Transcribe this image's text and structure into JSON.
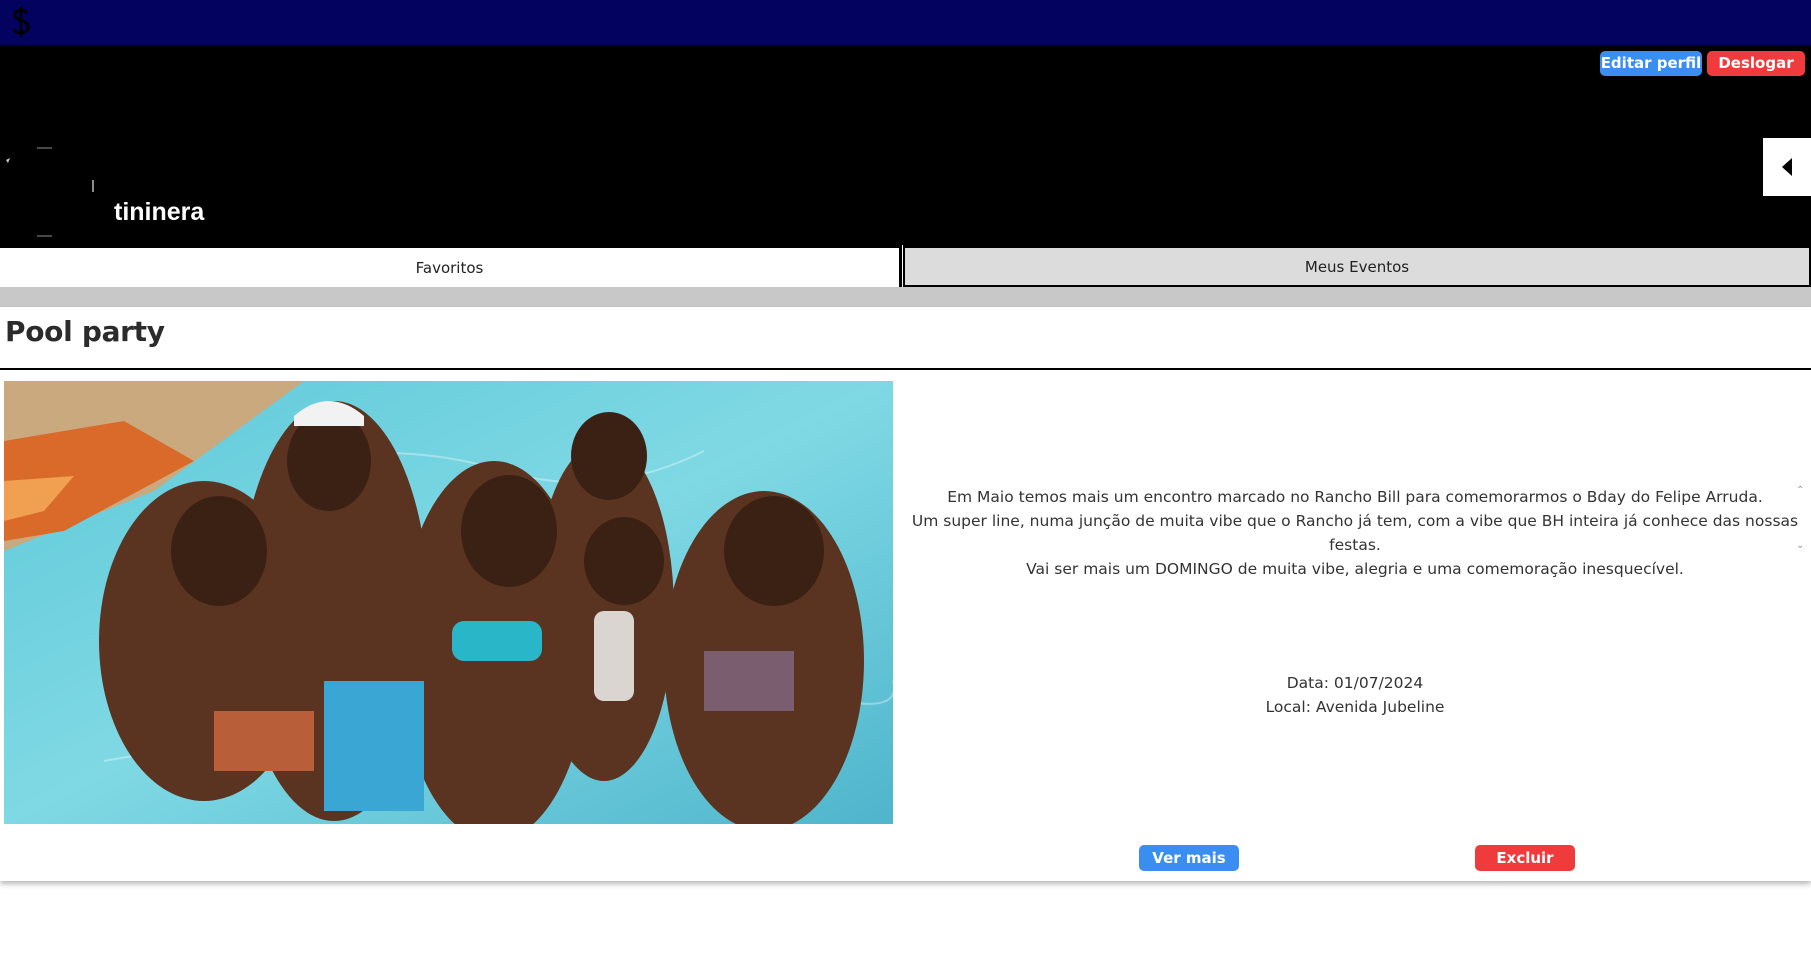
{
  "header": {
    "logo_icon": "dollar-sign-logo-icon",
    "background": "#03035f"
  },
  "profile": {
    "username": "tininera",
    "edit_profile_label": "Editar perfil",
    "logout_label": "Deslogar",
    "avatar_icon": "avatar-icon",
    "toggle_icon": "caret-left-icon"
  },
  "tabs": [
    {
      "label": "Favoritos",
      "active": true
    },
    {
      "label": "Meus Eventos",
      "active": false
    }
  ],
  "event": {
    "title": "Pool party",
    "image_icon": "event-photo",
    "description": [
      "Em Maio temos mais um encontro marcado no Rancho Bill para comemorarmos o Bday do Felipe Arruda.",
      "Um super line, numa junção de muita vibe que o Rancho já tem, com a vibe que BH inteira já conhece das nossas festas.",
      "Vai ser mais um DOMINGO de muita vibe, alegria e uma comemoração inesquecível."
    ],
    "date_text": "Data: 01/07/2024",
    "location_text": "Local: Avenida Jubeline",
    "see_more_label": "Ver mais",
    "delete_label": "Excluir"
  },
  "colors": {
    "primary": "#3a8ef0",
    "danger": "#ef3b3b",
    "navbar": "#03035f"
  }
}
